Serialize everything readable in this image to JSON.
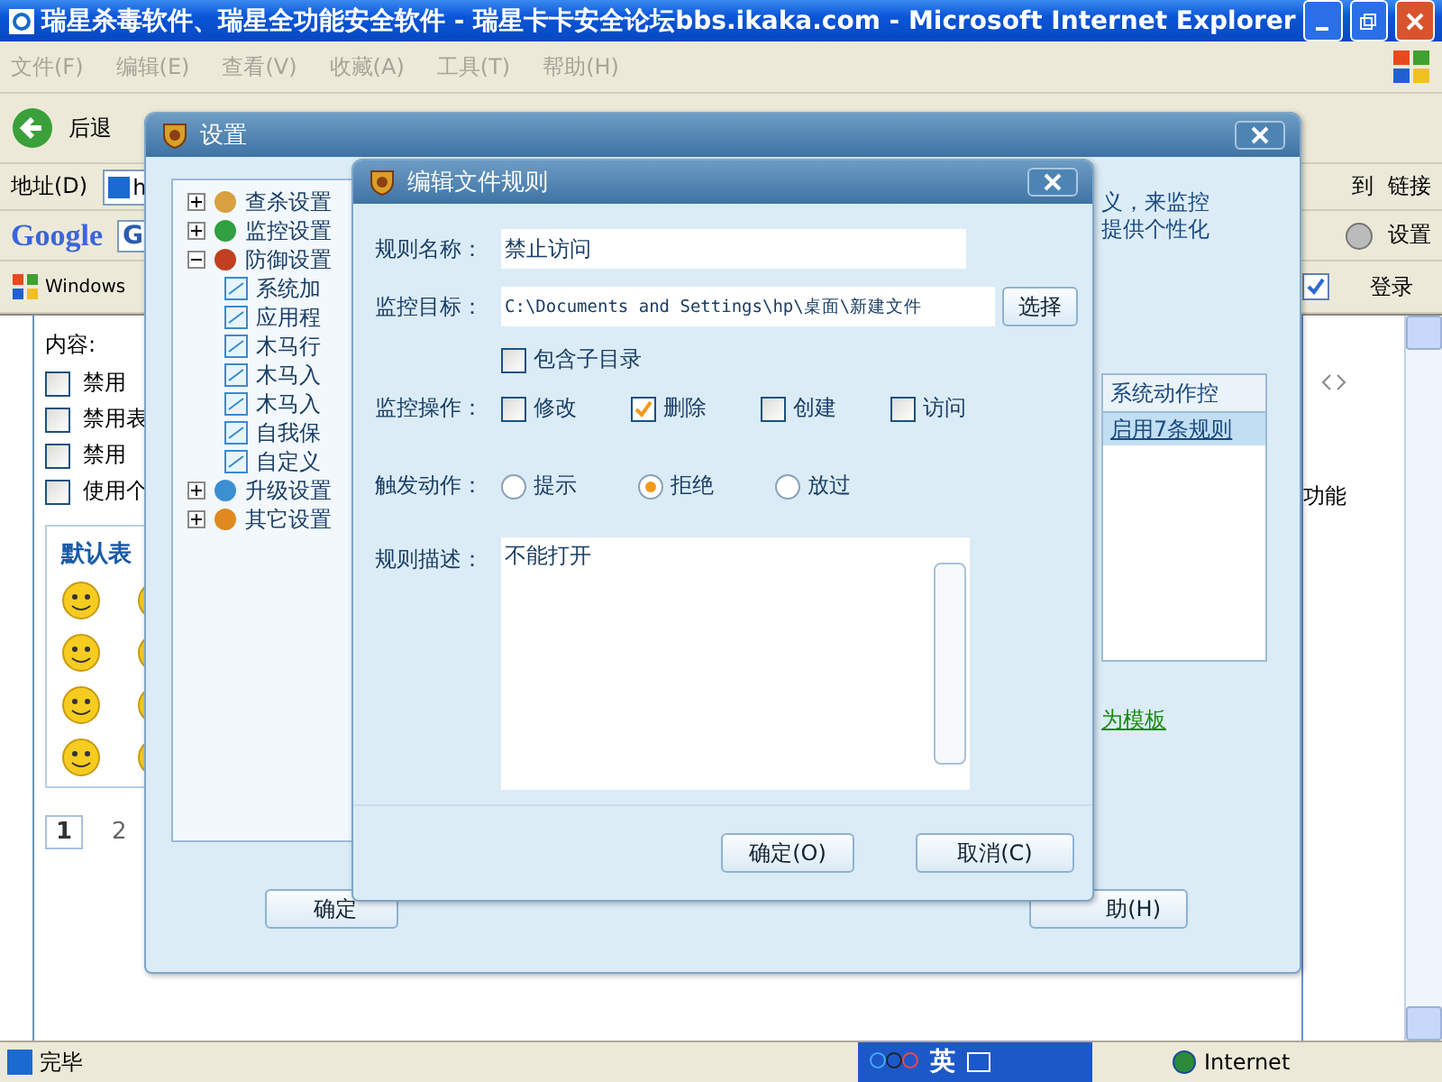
{
  "browser": {
    "title": "瑞星杀毒软件、瑞星全功能安全软件 - 瑞星卡卡安全论坛bbs.ikaka.com - Microsoft Internet Explorer",
    "menu": [
      {
        "label": "文件(F)"
      },
      {
        "label": "编辑(E)"
      },
      {
        "label": "查看(V)"
      },
      {
        "label": "收藏(A)"
      },
      {
        "label": "工具(T)"
      },
      {
        "label": "帮助(H)"
      }
    ],
    "back_label": "后退",
    "address": {
      "label": "地址(D)",
      "value": "h",
      "go_label": "到",
      "links_label": "链接"
    },
    "google_bar": {
      "logo": "Google",
      "search_prefix": "G",
      "settings_label": "设置"
    },
    "links_bar": {
      "item": "Windows",
      "login": "登录"
    },
    "page": {
      "content_label": "内容:",
      "options": [
        {
          "label": "禁用",
          "checked": false
        },
        {
          "label": "禁用表",
          "checked": false
        },
        {
          "label": "禁用",
          "checked": false
        },
        {
          "label": "使用个",
          "checked": false
        }
      ],
      "emoticons_title": "默认表",
      "pages": [
        {
          "label": "1",
          "selected": true
        },
        {
          "label": "2",
          "selected": false
        }
      ],
      "right_text": "功能"
    },
    "status_bar": {
      "text": "完毕",
      "ime": "英",
      "zone": "Internet"
    }
  },
  "settings_dialog": {
    "title": "设置",
    "tree": [
      {
        "label": "查杀设置",
        "expanded": false
      },
      {
        "label": "监控设置",
        "expanded": false
      },
      {
        "label": "防御设置",
        "expanded": true,
        "children": [
          {
            "label": "系统加"
          },
          {
            "label": "应用程"
          },
          {
            "label": "木马行"
          },
          {
            "label": "木马入"
          },
          {
            "label": "木马入"
          },
          {
            "label": "自我保"
          },
          {
            "label": "自定义"
          }
        ]
      },
      {
        "label": "升级设置",
        "expanded": false
      },
      {
        "label": "其它设置",
        "expanded": false
      }
    ],
    "description": [
      "义，来监控",
      "提供个性化"
    ],
    "table": {
      "column": "系统动作控",
      "rows": [
        {
          "text": "启用7条规则",
          "selected": true
        }
      ]
    },
    "template_link": "为模板",
    "buttons": [
      {
        "label": "确定"
      },
      {
        "label": "助(H)"
      }
    ]
  },
  "edit_dialog": {
    "title": "编辑文件规则",
    "name": {
      "label": "规则名称：",
      "value": "禁止访问"
    },
    "target": {
      "label": "监控目标：",
      "value": "C:\\Documents and Settings\\hp\\桌面\\新建文件",
      "button": "选择"
    },
    "include_subdirs": {
      "label": "包含子目录",
      "checked": false
    },
    "operations": {
      "label": "监控操作：",
      "options": [
        {
          "label": "修改",
          "checked": false
        },
        {
          "label": "删除",
          "checked": true
        },
        {
          "label": "创建",
          "checked": false
        },
        {
          "label": "访问",
          "checked": false
        }
      ]
    },
    "trigger": {
      "label": "触发动作：",
      "options": [
        {
          "label": "提示",
          "selected": false
        },
        {
          "label": "拒绝",
          "selected": true
        },
        {
          "label": "放过",
          "selected": false
        }
      ]
    },
    "description": {
      "label": "规则描述：",
      "value": "不能打开"
    },
    "buttons": [
      {
        "label": "确定(O)"
      },
      {
        "label": "取消(C)"
      }
    ]
  }
}
